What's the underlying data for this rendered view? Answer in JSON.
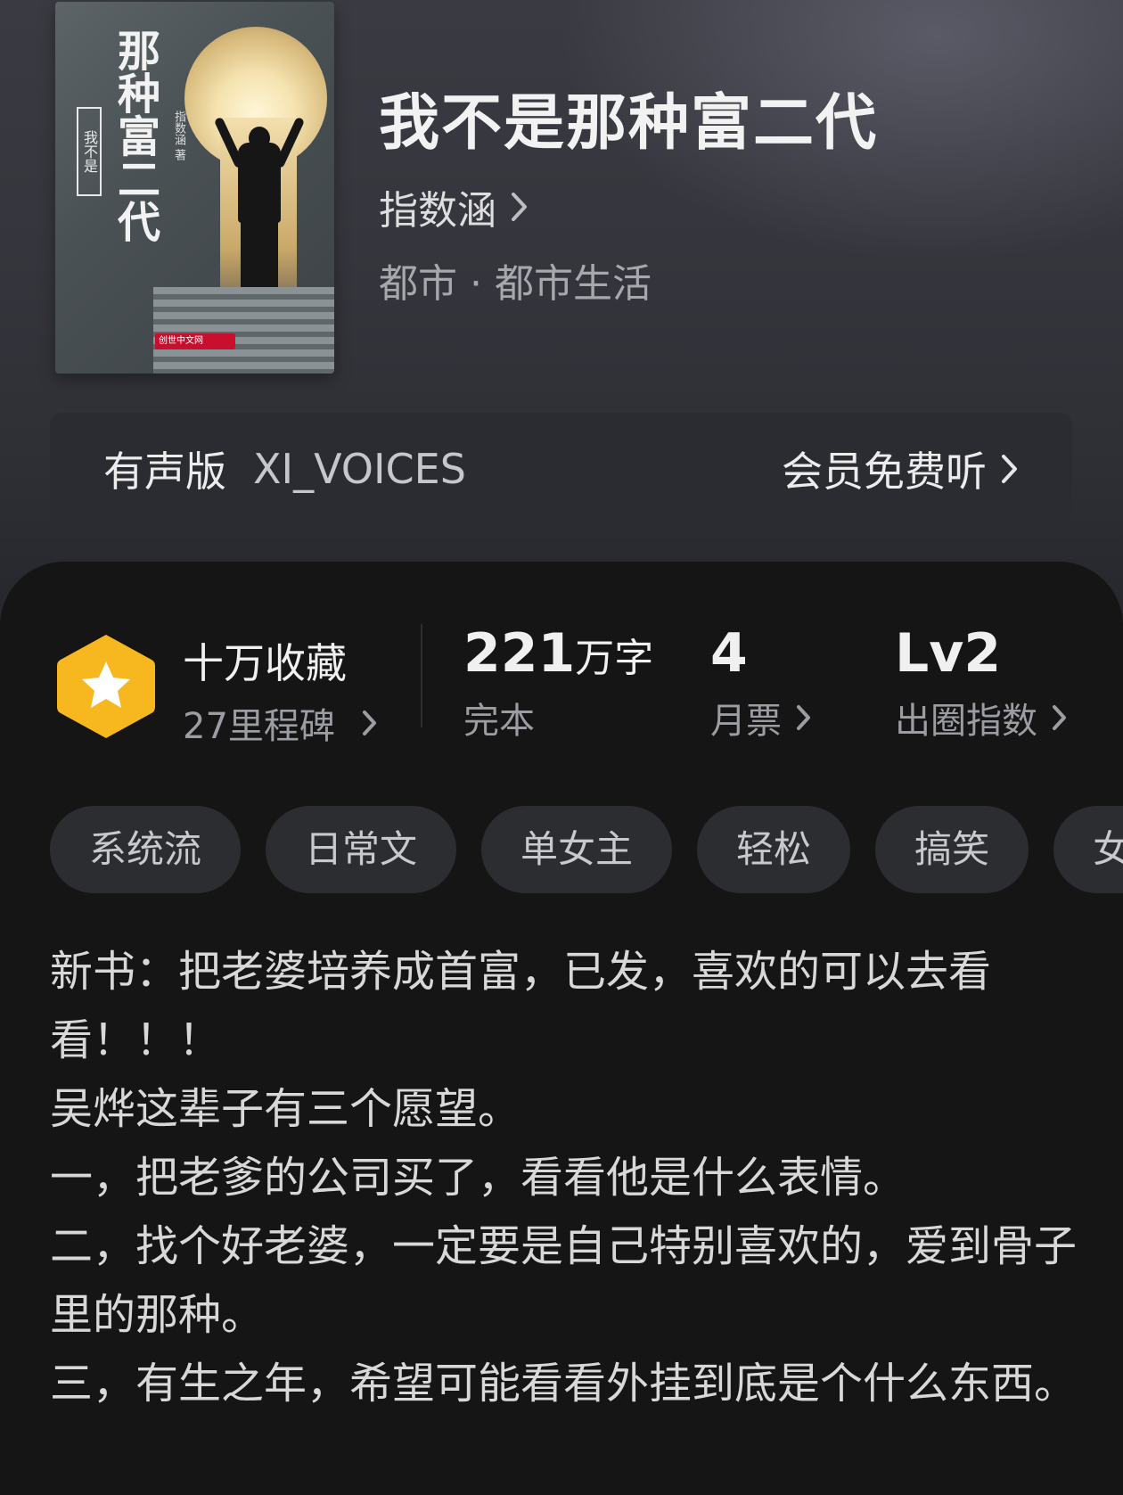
{
  "book": {
    "title": "我不是那种富二代",
    "author": "指数涵",
    "category": "都市 · 都市生活",
    "cover": {
      "title_text": "那种富二代",
      "sub_text": "我不是",
      "author_text": "指数涵 著",
      "publisher_logo": "创世中文网"
    }
  },
  "audio": {
    "label": "有声版",
    "narrator": "XI_VOICES",
    "cta": "会员免费听"
  },
  "stats": {
    "collect_title": "十万收藏",
    "collect_sub": "27里程碑",
    "words_num": "221",
    "words_unit": "万字",
    "words_sub": "完本",
    "monthly_num": "4",
    "monthly_sub": "月票",
    "level_num": "Lv2",
    "level_sub": "出圈指数"
  },
  "tags": [
    "系统流",
    "日常文",
    "单女主",
    "轻松",
    "搞笑",
    "女神"
  ],
  "description": [
    "新书：把老婆培养成首富，已发，喜欢的可以去看看！！！",
    "吴烨这辈子有三个愿望。",
    "一，把老爹的公司买了，看看他是什么表情。",
    "二，找个好老婆，一定要是自己特别喜欢的，爱到骨子里的那种。",
    "三，有生之年，希望可能看看外挂到底是个什么东西。"
  ],
  "colors": {
    "badge": "#f7b81f",
    "panel": "#151515",
    "header": "#35363d"
  }
}
